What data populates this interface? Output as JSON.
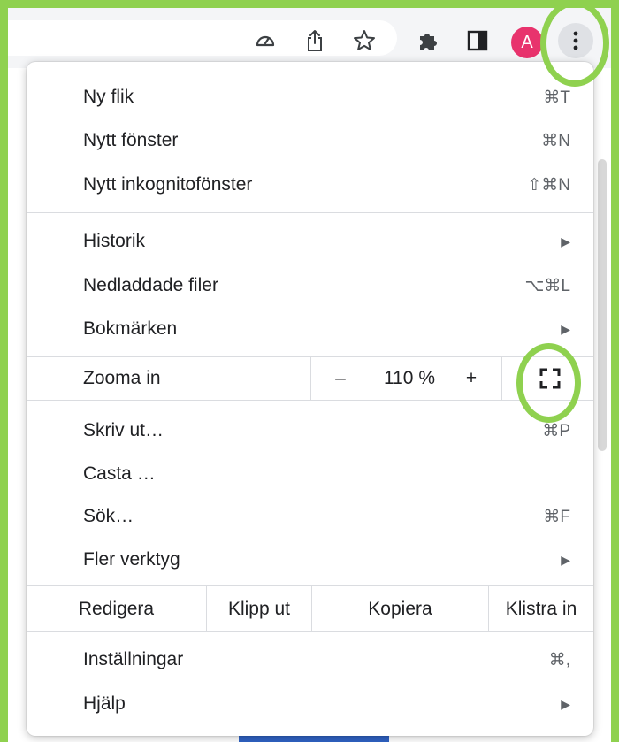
{
  "toolbar": {
    "icons": [
      "performance-icon",
      "share-icon",
      "bookmark-star-icon",
      "extensions-puzzle-icon",
      "side-panel-icon"
    ],
    "avatar_letter": "A",
    "menu_button": "chrome-menu-kebab-icon"
  },
  "menu": {
    "new_tab": {
      "label": "Ny flik",
      "shortcut": "⌘T"
    },
    "new_window": {
      "label": "Nytt fönster",
      "shortcut": "⌘N"
    },
    "new_incognito": {
      "label": "Nytt inkognitofönster",
      "shortcut": "⇧⌘N"
    },
    "history": {
      "label": "Historik"
    },
    "downloads": {
      "label": "Nedladdade filer",
      "shortcut": "⌥⌘L"
    },
    "bookmarks": {
      "label": "Bokmärken"
    },
    "zoom": {
      "label": "Zooma in",
      "minus": "–",
      "value": "110 %",
      "plus": "+"
    },
    "print": {
      "label": "Skriv ut…",
      "shortcut": "⌘P"
    },
    "cast": {
      "label": "Casta …"
    },
    "find": {
      "label": "Sök…",
      "shortcut": "⌘F"
    },
    "more_tools": {
      "label": "Fler verktyg"
    },
    "edit": {
      "label": "Redigera",
      "cut": "Klipp ut",
      "copy": "Kopiera",
      "paste": "Klistra in"
    },
    "settings": {
      "label": "Inställningar",
      "shortcut": "⌘,"
    },
    "help": {
      "label": "Hjälp"
    }
  },
  "colors": {
    "highlight": "#8fd14f",
    "avatar": "#e8336d"
  }
}
